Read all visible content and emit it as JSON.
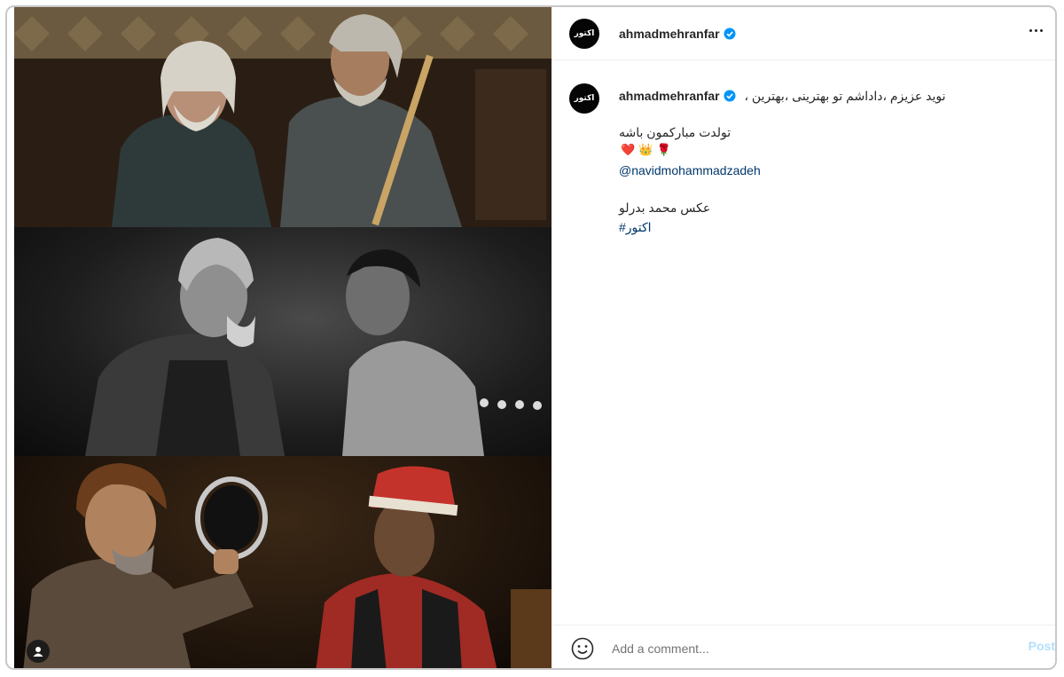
{
  "post": {
    "username": "ahmadmehranfar",
    "avatar_text": "اکتور",
    "verified": true,
    "caption": {
      "line1": "نوید عزیزم ،داداشم تو بهترینی ،بهترین ،",
      "line2": "تولدت مبارکمون باشه",
      "emojis": "❤️ 👑 🌹",
      "mention": "@navidmohammadzadeh",
      "line4": "عکس محمد بدرلو",
      "hashtag": "اکتور#"
    }
  },
  "comment": {
    "placeholder": "Add a comment...",
    "post_label": "Post"
  },
  "icons": {
    "verified": "verified-badge-icon",
    "more": "more-options-icon",
    "emoji": "emoji-smiley-icon",
    "tagged_user": "tagged-user-icon"
  },
  "colors": {
    "verified": "#0095f6",
    "post_disabled": "#b2dffc",
    "mention": "#00376b"
  }
}
